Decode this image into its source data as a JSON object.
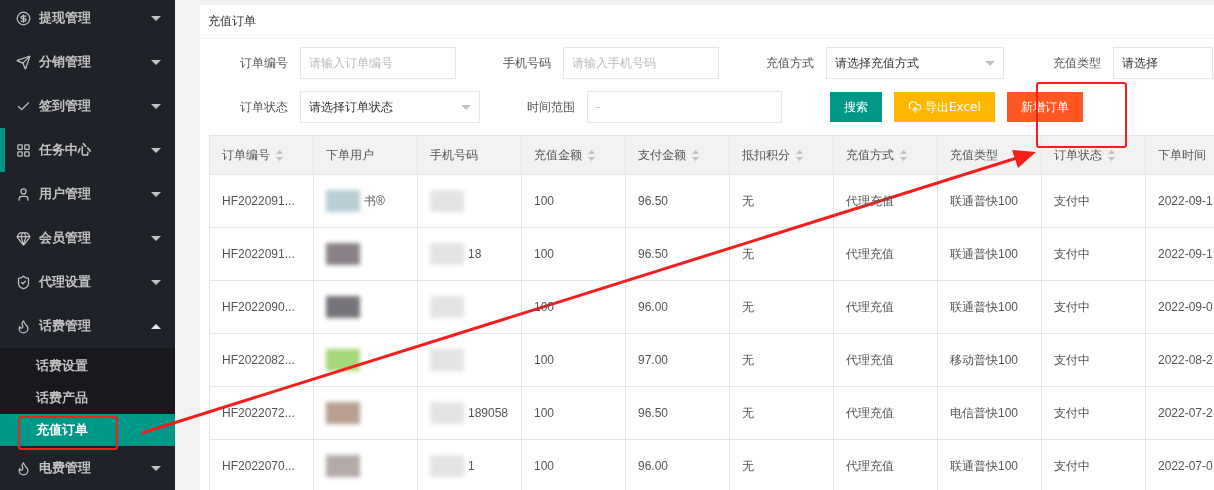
{
  "sidebar": {
    "items": [
      {
        "label": "提现管理",
        "expanded": false,
        "current": false
      },
      {
        "label": "分销管理",
        "expanded": false,
        "current": false
      },
      {
        "label": "签到管理",
        "expanded": false,
        "current": false
      },
      {
        "label": "任务中心",
        "expanded": false,
        "current": true
      },
      {
        "label": "用户管理",
        "expanded": false,
        "current": false
      },
      {
        "label": "会员管理",
        "expanded": false,
        "current": false
      },
      {
        "label": "代理设置",
        "expanded": false,
        "current": false
      },
      {
        "label": "话费管理",
        "expanded": true,
        "current": false,
        "children": [
          {
            "label": "话费设置",
            "selected": false
          },
          {
            "label": "话费产品",
            "selected": false
          },
          {
            "label": "充值订单",
            "selected": true
          }
        ]
      },
      {
        "label": "电费管理",
        "expanded": false,
        "current": false
      }
    ]
  },
  "page": {
    "title": "充值订单"
  },
  "filters": [
    {
      "label": "订单编号",
      "kind": "input",
      "placeholder": "请输入订单编号"
    },
    {
      "label": "手机号码",
      "kind": "input",
      "placeholder": "请输入手机号码"
    },
    {
      "label": "充值方式",
      "kind": "select",
      "value": "请选择充值方式"
    },
    {
      "label": "充值类型",
      "kind": "select",
      "value": "请选择"
    },
    {
      "label": "订单状态",
      "kind": "select",
      "value": "请选择订单状态"
    },
    {
      "label": "时间范围",
      "kind": "input",
      "placeholder": "-"
    }
  ],
  "buttons": [
    {
      "label": "搜索",
      "kind": "search"
    },
    {
      "label": "导出Excel",
      "kind": "export"
    },
    {
      "label": "新增订单",
      "kind": "add"
    }
  ],
  "table": {
    "columns": [
      {
        "label": "订单编号",
        "sortable": true
      },
      {
        "label": "下单用户",
        "sortable": false
      },
      {
        "label": "手机号码",
        "sortable": false
      },
      {
        "label": "充值金额",
        "sortable": true
      },
      {
        "label": "支付金额",
        "sortable": true
      },
      {
        "label": "抵扣积分",
        "sortable": true
      },
      {
        "label": "充值方式",
        "sortable": true
      },
      {
        "label": "充值类型",
        "sortable": false
      },
      {
        "label": "订单状态",
        "sortable": true
      },
      {
        "label": "下单时间",
        "sortable": false
      }
    ],
    "rows": [
      {
        "cells": [
          "HF2022091...",
          "书®",
          "",
          "100",
          "96.50",
          "无",
          "代理充值",
          "联通普快100",
          "支付中",
          "2022-09-1"
        ]
      },
      {
        "cells": [
          "HF2022091...",
          "",
          "18",
          "100",
          "96.50",
          "无",
          "代理充值",
          "联通普快100",
          "支付中",
          "2022-09-1"
        ]
      },
      {
        "cells": [
          "HF2022090...",
          "",
          "",
          "100",
          "96.00",
          "无",
          "代理充值",
          "联通普快100",
          "支付中",
          "2022-09-0"
        ]
      },
      {
        "cells": [
          "HF2022082...",
          "",
          "",
          "100",
          "97.00",
          "无",
          "代理充值",
          "移动普快100",
          "支付中",
          "2022-08-2"
        ]
      },
      {
        "cells": [
          "HF2022072...",
          "",
          "189058",
          "100",
          "96.50",
          "无",
          "代理充值",
          "电信普快100",
          "支付中",
          "2022-07-2"
        ]
      },
      {
        "cells": [
          "HF2022070...",
          "",
          "1",
          "100",
          "96.00",
          "无",
          "代理充值",
          "联通普快100",
          "支付中",
          "2022-07-0"
        ]
      }
    ]
  }
}
